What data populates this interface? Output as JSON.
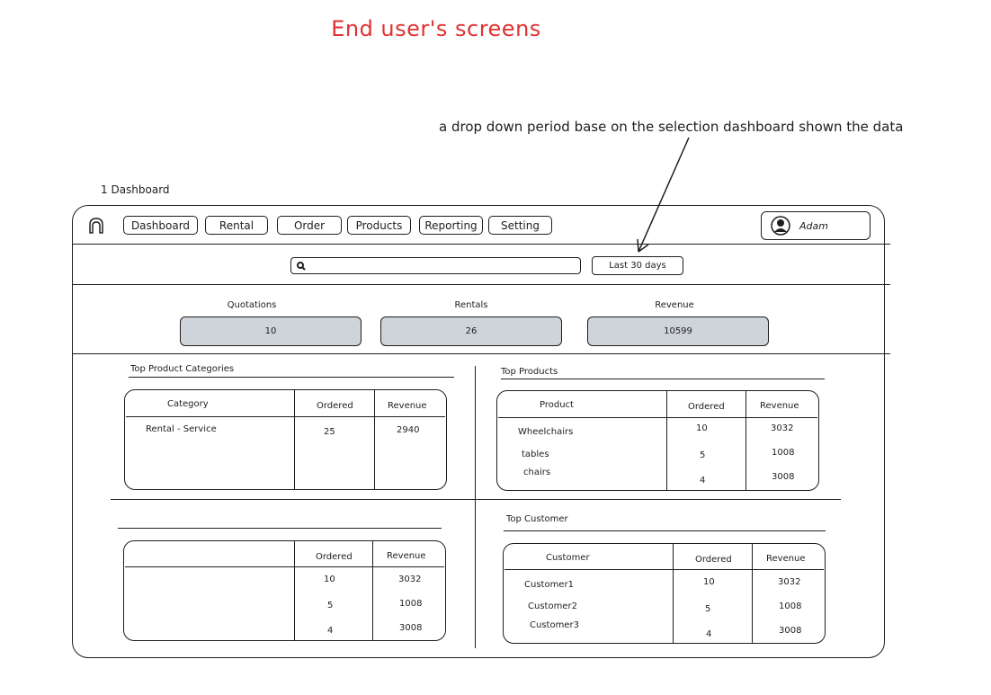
{
  "header": {
    "title": "End user's screens",
    "annotation": "a drop down period base on the selection dashboard shown the data",
    "section_label": "1 Dashboard"
  },
  "nav": {
    "items": [
      "Dashboard",
      "Rental",
      "Order",
      "Products",
      "Reporting",
      "Setting"
    ],
    "user_name": "Adam"
  },
  "filters": {
    "search_value": "",
    "period": "Last 30 days"
  },
  "kpis": [
    {
      "label": "Quotations",
      "value": "10"
    },
    {
      "label": "Rentals",
      "value": "26"
    },
    {
      "label": "Revenue",
      "value": "10599"
    }
  ],
  "top_categories": {
    "title": "Top Product Categories",
    "headers": [
      "Category",
      "Ordered",
      "Revenue"
    ],
    "rows": [
      [
        "Rental - Service",
        "25",
        "2940"
      ]
    ]
  },
  "top_products": {
    "title": "Top Products",
    "headers": [
      "Product",
      "Ordered",
      "Revenue"
    ],
    "rows": [
      [
        "Wheelchairs",
        "10",
        "3032"
      ],
      [
        "tables",
        "5",
        "1008"
      ],
      [
        "chairs",
        "4",
        "3008"
      ]
    ]
  },
  "unnamed_table": {
    "title": "",
    "headers": [
      "",
      "Ordered",
      "Revenue"
    ],
    "rows": [
      [
        "",
        "10",
        "3032"
      ],
      [
        "",
        "5",
        "1008"
      ],
      [
        "",
        "4",
        "3008"
      ]
    ]
  },
  "top_customer": {
    "title": "Top Customer",
    "headers": [
      "Customer",
      "Ordered",
      "Revenue"
    ],
    "rows": [
      [
        "Customer1",
        "10",
        "3032"
      ],
      [
        "Customer2",
        "5",
        "1008"
      ],
      [
        "Customer3",
        "4",
        "3008"
      ]
    ]
  },
  "colors": {
    "title_red": "#e03131",
    "kpi_fill": "#ced4da",
    "stroke": "#1e1e1e"
  },
  "icons": [
    "home-icon",
    "search-icon",
    "user-avatar-icon",
    "arrow-annotation-icon"
  ]
}
